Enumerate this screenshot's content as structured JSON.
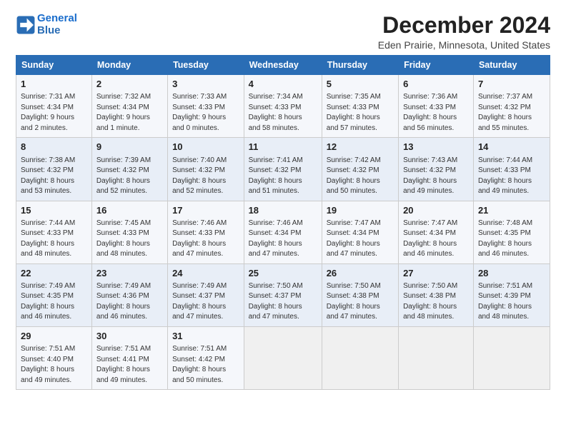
{
  "header": {
    "logo_line1": "General",
    "logo_line2": "Blue",
    "title": "December 2024",
    "subtitle": "Eden Prairie, Minnesota, United States"
  },
  "weekdays": [
    "Sunday",
    "Monday",
    "Tuesday",
    "Wednesday",
    "Thursday",
    "Friday",
    "Saturday"
  ],
  "weeks": [
    [
      {
        "day": "1",
        "info": "Sunrise: 7:31 AM\nSunset: 4:34 PM\nDaylight: 9 hours\nand 2 minutes."
      },
      {
        "day": "2",
        "info": "Sunrise: 7:32 AM\nSunset: 4:34 PM\nDaylight: 9 hours\nand 1 minute."
      },
      {
        "day": "3",
        "info": "Sunrise: 7:33 AM\nSunset: 4:33 PM\nDaylight: 9 hours\nand 0 minutes."
      },
      {
        "day": "4",
        "info": "Sunrise: 7:34 AM\nSunset: 4:33 PM\nDaylight: 8 hours\nand 58 minutes."
      },
      {
        "day": "5",
        "info": "Sunrise: 7:35 AM\nSunset: 4:33 PM\nDaylight: 8 hours\nand 57 minutes."
      },
      {
        "day": "6",
        "info": "Sunrise: 7:36 AM\nSunset: 4:33 PM\nDaylight: 8 hours\nand 56 minutes."
      },
      {
        "day": "7",
        "info": "Sunrise: 7:37 AM\nSunset: 4:32 PM\nDaylight: 8 hours\nand 55 minutes."
      }
    ],
    [
      {
        "day": "8",
        "info": "Sunrise: 7:38 AM\nSunset: 4:32 PM\nDaylight: 8 hours\nand 53 minutes."
      },
      {
        "day": "9",
        "info": "Sunrise: 7:39 AM\nSunset: 4:32 PM\nDaylight: 8 hours\nand 52 minutes."
      },
      {
        "day": "10",
        "info": "Sunrise: 7:40 AM\nSunset: 4:32 PM\nDaylight: 8 hours\nand 52 minutes."
      },
      {
        "day": "11",
        "info": "Sunrise: 7:41 AM\nSunset: 4:32 PM\nDaylight: 8 hours\nand 51 minutes."
      },
      {
        "day": "12",
        "info": "Sunrise: 7:42 AM\nSunset: 4:32 PM\nDaylight: 8 hours\nand 50 minutes."
      },
      {
        "day": "13",
        "info": "Sunrise: 7:43 AM\nSunset: 4:32 PM\nDaylight: 8 hours\nand 49 minutes."
      },
      {
        "day": "14",
        "info": "Sunrise: 7:44 AM\nSunset: 4:33 PM\nDaylight: 8 hours\nand 49 minutes."
      }
    ],
    [
      {
        "day": "15",
        "info": "Sunrise: 7:44 AM\nSunset: 4:33 PM\nDaylight: 8 hours\nand 48 minutes."
      },
      {
        "day": "16",
        "info": "Sunrise: 7:45 AM\nSunset: 4:33 PM\nDaylight: 8 hours\nand 48 minutes."
      },
      {
        "day": "17",
        "info": "Sunrise: 7:46 AM\nSunset: 4:33 PM\nDaylight: 8 hours\nand 47 minutes."
      },
      {
        "day": "18",
        "info": "Sunrise: 7:46 AM\nSunset: 4:34 PM\nDaylight: 8 hours\nand 47 minutes."
      },
      {
        "day": "19",
        "info": "Sunrise: 7:47 AM\nSunset: 4:34 PM\nDaylight: 8 hours\nand 47 minutes."
      },
      {
        "day": "20",
        "info": "Sunrise: 7:47 AM\nSunset: 4:34 PM\nDaylight: 8 hours\nand 46 minutes."
      },
      {
        "day": "21",
        "info": "Sunrise: 7:48 AM\nSunset: 4:35 PM\nDaylight: 8 hours\nand 46 minutes."
      }
    ],
    [
      {
        "day": "22",
        "info": "Sunrise: 7:49 AM\nSunset: 4:35 PM\nDaylight: 8 hours\nand 46 minutes."
      },
      {
        "day": "23",
        "info": "Sunrise: 7:49 AM\nSunset: 4:36 PM\nDaylight: 8 hours\nand 46 minutes."
      },
      {
        "day": "24",
        "info": "Sunrise: 7:49 AM\nSunset: 4:37 PM\nDaylight: 8 hours\nand 47 minutes."
      },
      {
        "day": "25",
        "info": "Sunrise: 7:50 AM\nSunset: 4:37 PM\nDaylight: 8 hours\nand 47 minutes."
      },
      {
        "day": "26",
        "info": "Sunrise: 7:50 AM\nSunset: 4:38 PM\nDaylight: 8 hours\nand 47 minutes."
      },
      {
        "day": "27",
        "info": "Sunrise: 7:50 AM\nSunset: 4:38 PM\nDaylight: 8 hours\nand 48 minutes."
      },
      {
        "day": "28",
        "info": "Sunrise: 7:51 AM\nSunset: 4:39 PM\nDaylight: 8 hours\nand 48 minutes."
      }
    ],
    [
      {
        "day": "29",
        "info": "Sunrise: 7:51 AM\nSunset: 4:40 PM\nDaylight: 8 hours\nand 49 minutes."
      },
      {
        "day": "30",
        "info": "Sunrise: 7:51 AM\nSunset: 4:41 PM\nDaylight: 8 hours\nand 49 minutes."
      },
      {
        "day": "31",
        "info": "Sunrise: 7:51 AM\nSunset: 4:42 PM\nDaylight: 8 hours\nand 50 minutes."
      },
      {
        "day": "",
        "info": ""
      },
      {
        "day": "",
        "info": ""
      },
      {
        "day": "",
        "info": ""
      },
      {
        "day": "",
        "info": ""
      }
    ]
  ]
}
